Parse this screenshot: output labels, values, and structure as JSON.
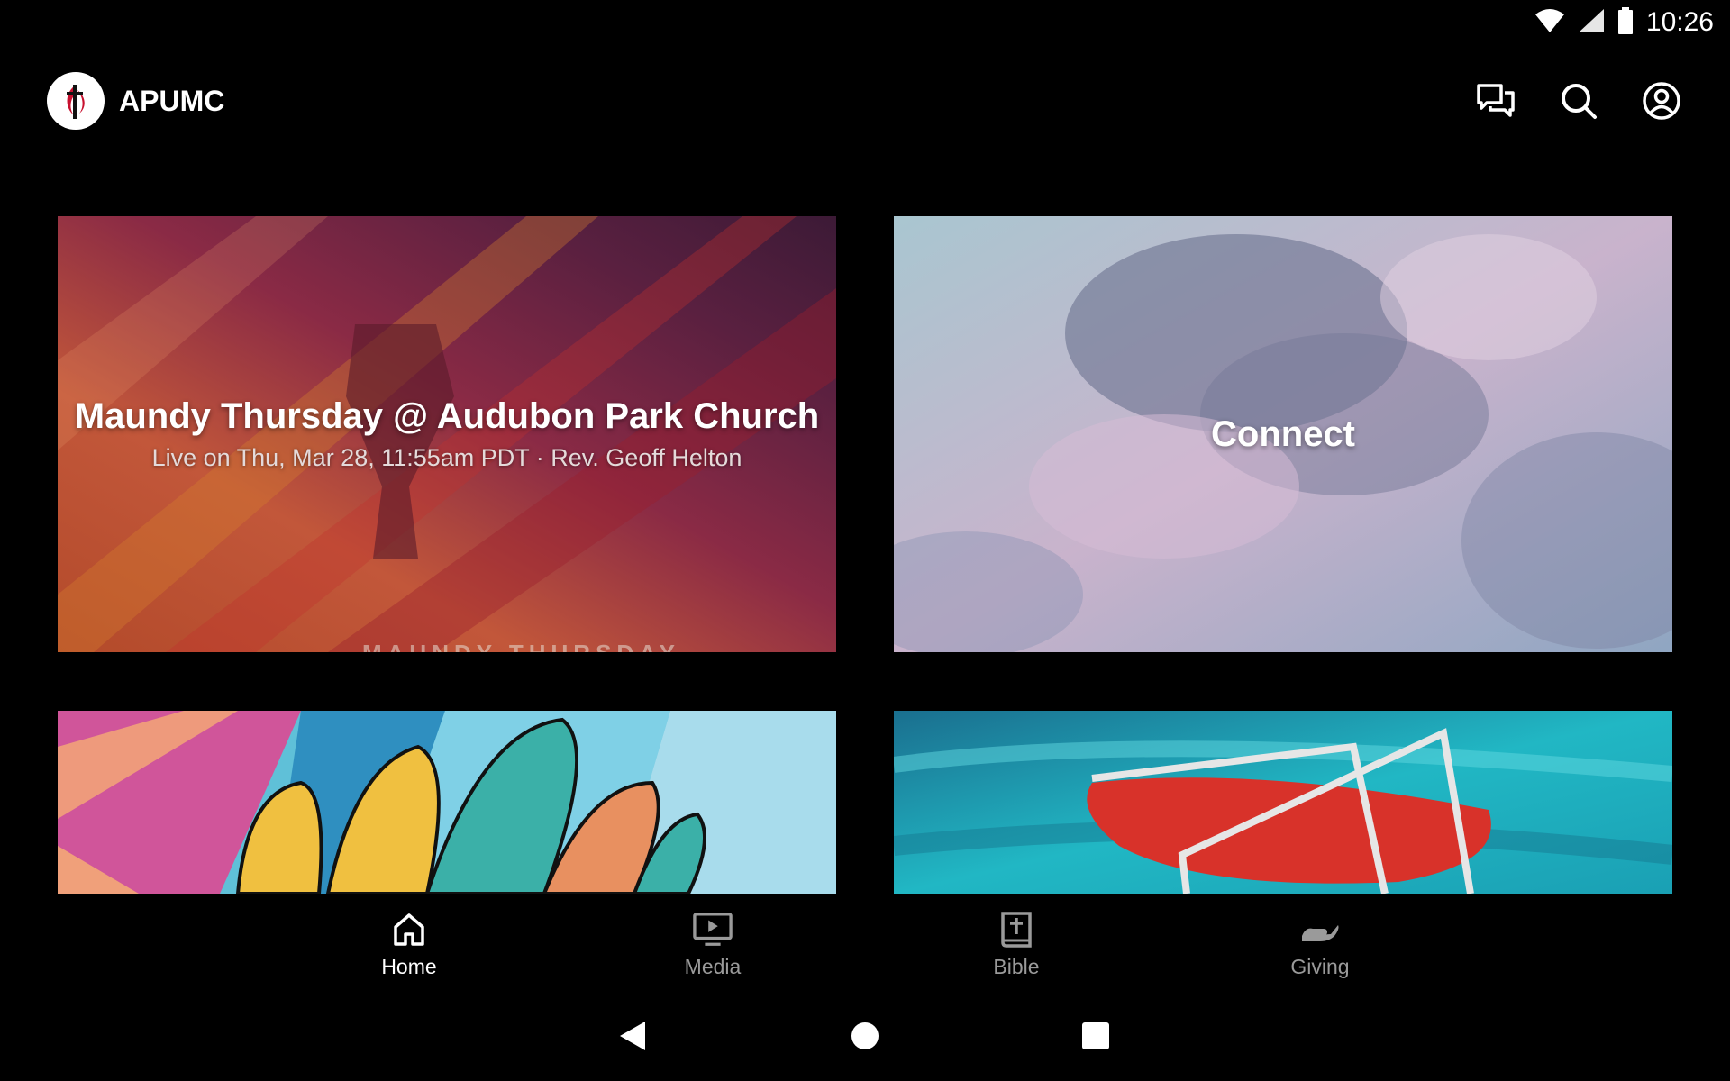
{
  "status_bar": {
    "time": "10:26",
    "icons": [
      "wifi-icon",
      "cell-signal-icon",
      "battery-icon"
    ]
  },
  "app_bar": {
    "title": "APUMC",
    "actions": [
      "chat-icon",
      "search-icon",
      "account-icon"
    ]
  },
  "cards": [
    {
      "title": "Maundy Thursday @ Audubon Park Church",
      "subtitle": "Live on Thu, Mar 28, 11:55am PDT · Rev. Geoff Helton",
      "overlay_word": "MAUNDY THURSDAY"
    },
    {
      "title": "Connect"
    },
    {
      "title": ""
    },
    {
      "title": ""
    }
  ],
  "bottom_nav": {
    "active": "Home",
    "items": [
      {
        "label": "Home",
        "icon": "home-icon"
      },
      {
        "label": "Media",
        "icon": "media-icon"
      },
      {
        "label": "Bible",
        "icon": "bible-icon"
      },
      {
        "label": "Giving",
        "icon": "giving-icon"
      }
    ]
  },
  "system_nav": [
    "back-icon",
    "home-circle-icon",
    "recents-icon"
  ],
  "colors": {
    "background": "#000000",
    "nav_active": "#ffffff",
    "nav_inactive": "#9a9a9a",
    "logo_red": "#c8102e"
  }
}
